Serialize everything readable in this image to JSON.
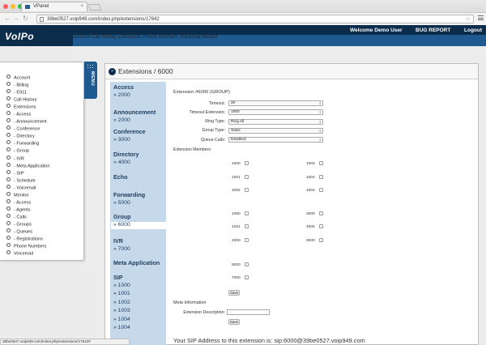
{
  "browser": {
    "tab_title": "VPanel",
    "url": "39be0527.voip949.com/index.php/extensions/17642",
    "status_url": "39be0527.voip949.com/index.php/extensions/17642#"
  },
  "header": {
    "logo": "VoIPo",
    "welcome": "Welcome Demo User",
    "bug_report": "BUG REPORT",
    "logout": "Logout",
    "nav": [
      "Account",
      "Call History",
      "Extensions",
      "Phone Numbers",
      "Voicemail",
      "Monitor"
    ]
  },
  "menu_tab": "MENU",
  "sidebar": [
    "Account",
    "- Billing",
    "- E911",
    "Call History",
    "Extensions",
    "- Access",
    "- Announcement",
    "- Conference",
    "- Directory",
    "- Forwarding",
    "- Group",
    "- IVR",
    "- Meta Application",
    "- SIP",
    "- Schedule",
    "- Voicemail",
    "Monitor",
    "- Access",
    "- Agents",
    "- Calls",
    "- Groups",
    "- Queues",
    "- Registrations",
    "Phone Numbers",
    "Voicemail"
  ],
  "page": {
    "title": "Extensions / 6000"
  },
  "categories": [
    {
      "name": "Access",
      "items": [
        "» 2000"
      ]
    },
    {
      "name": "Announcement",
      "items": [
        "» 2000"
      ]
    },
    {
      "name": "Conference",
      "items": [
        "» 3000"
      ]
    },
    {
      "name": "Directory",
      "items": [
        "» 4000"
      ]
    },
    {
      "name": "Echo",
      "items": []
    },
    {
      "name": "Forwarding",
      "items": [
        "» 5000"
      ]
    },
    {
      "name": "Group",
      "items": [
        "» 6000"
      ]
    },
    {
      "name": "IVR",
      "items": [
        "» 7000"
      ]
    },
    {
      "name": "Meta Application",
      "items": []
    },
    {
      "name": "SIP",
      "items": [
        "» 1000",
        "» 1001",
        "» 1002",
        "» 1003",
        "» 1004",
        "» 1004"
      ]
    }
  ],
  "form": {
    "heading": "Extension #6000 (GROUP)",
    "fields": [
      {
        "label": "Timeout:",
        "value": "20"
      },
      {
        "label": "Timeout Extension:",
        "value": "1000"
      },
      {
        "label": "Ring Type:",
        "value": "Ring All"
      },
      {
        "label": "Group Type:",
        "value": "Static"
      },
      {
        "label": "Queue Calls:",
        "value": "Disabled"
      }
    ],
    "members_label": "Extension Members:",
    "members": {
      "left": [
        "1000",
        "1001",
        "1002",
        "1050",
        "1051",
        "2000",
        "6000",
        "7000"
      ],
      "right": [
        "1003",
        "1004",
        "1004",
        "3000",
        "4000",
        "5000"
      ]
    },
    "save": "Save",
    "meta_heading": "Meta Information",
    "desc_label": "Extension Description:",
    "sip_address": "Your SIP Address to this extension is: sip:6000@39be0527.voip949.com"
  }
}
